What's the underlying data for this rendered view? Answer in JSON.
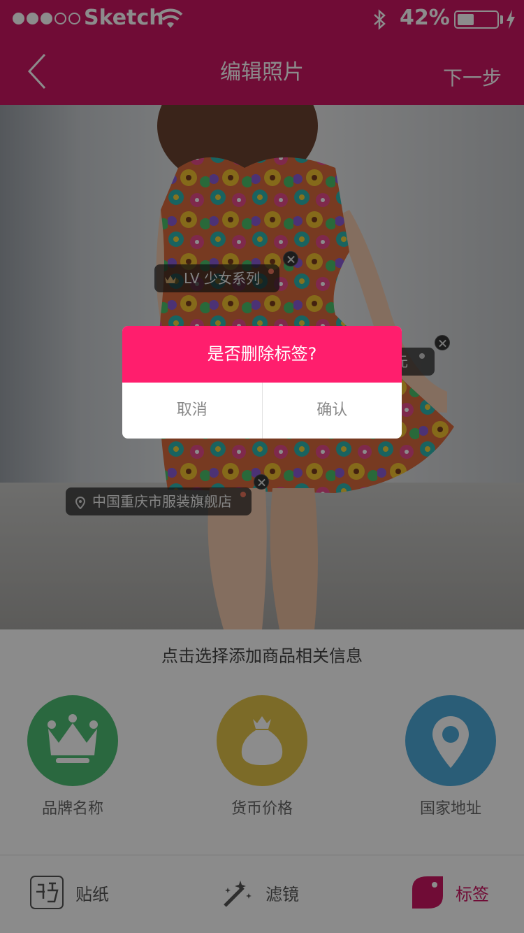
{
  "status_bar": {
    "carrier": "Sketch",
    "battery_percent": "42%",
    "battery_level": 0.42
  },
  "nav": {
    "title": "编辑照片",
    "next_label": "下一步"
  },
  "photo_tags": [
    {
      "label": "LV 少女系列",
      "icon": "crown-icon"
    },
    {
      "label": "元",
      "icon": "coin-icon"
    },
    {
      "label": "中国重庆市服装旗舰店",
      "icon": "location-pin-icon"
    }
  ],
  "panel": {
    "prompt": "点击选择添加商品相关信息",
    "options": [
      {
        "label": "品牌名称",
        "icon": "crown-icon",
        "color": "#4dbd74"
      },
      {
        "label": "货币价格",
        "icon": "money-bag-icon",
        "color": "#e2c44a"
      },
      {
        "label": "国家地址",
        "icon": "location-pin-icon",
        "color": "#4ea9d9"
      }
    ]
  },
  "tabbar": {
    "tabs": [
      {
        "label": "贴纸",
        "icon": "sticker-icon"
      },
      {
        "label": "滤镜",
        "icon": "magic-wand-icon"
      },
      {
        "label": "标签",
        "icon": "tag-icon",
        "active": true
      }
    ]
  },
  "dialog": {
    "title": "是否删除标签?",
    "cancel_label": "取消",
    "confirm_label": "确认"
  },
  "colors": {
    "brand": "#cc1663",
    "dialog_header": "#ff1e6d"
  }
}
